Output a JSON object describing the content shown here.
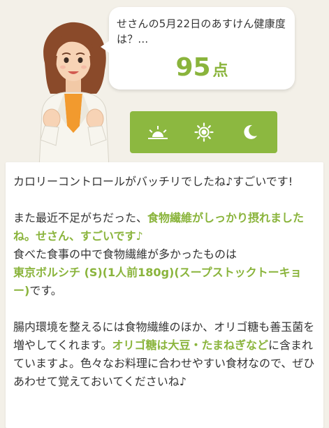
{
  "bubble": {
    "question": "せさんの5月22日のあすけん健康度は？...",
    "score_value": "95",
    "score_unit": "点"
  },
  "meal_bar": {
    "buttons": [
      {
        "icon": "sunrise-icon",
        "label": "朝食"
      },
      {
        "icon": "sun-icon",
        "label": "昼食"
      },
      {
        "icon": "moon-icon",
        "label": "夕食"
      }
    ]
  },
  "comment": {
    "p1": "カロリーコントロールがバッチリでしたね♪すごいです!",
    "p2_a": "また最近不足がちだった、",
    "p2_hl": "食物繊維がしっかり摂れましたね。せさん、すごいです♪",
    "p2_b": "食べた食事の中で食物繊維が多かったものは",
    "p2_food": "東京ボルシチ (S)(1人前180g)(スープストックトーキョー)",
    "p2_c": "です。",
    "p3_a": "腸内環境を整えるには食物繊維のほか、オリゴ糖も善玉菌を増やしてくれます。",
    "p3_hl": "オリゴ糖は大豆・たまねぎなど",
    "p3_b": "に含まれていますよ。色々なお料理に合わせやすい食材なので、ぜひあわせて覚えておいてくださいね♪"
  },
  "colors": {
    "accent": "#8ab43c",
    "meal_bar": "#8cb840",
    "background": "#f3f0e8"
  }
}
